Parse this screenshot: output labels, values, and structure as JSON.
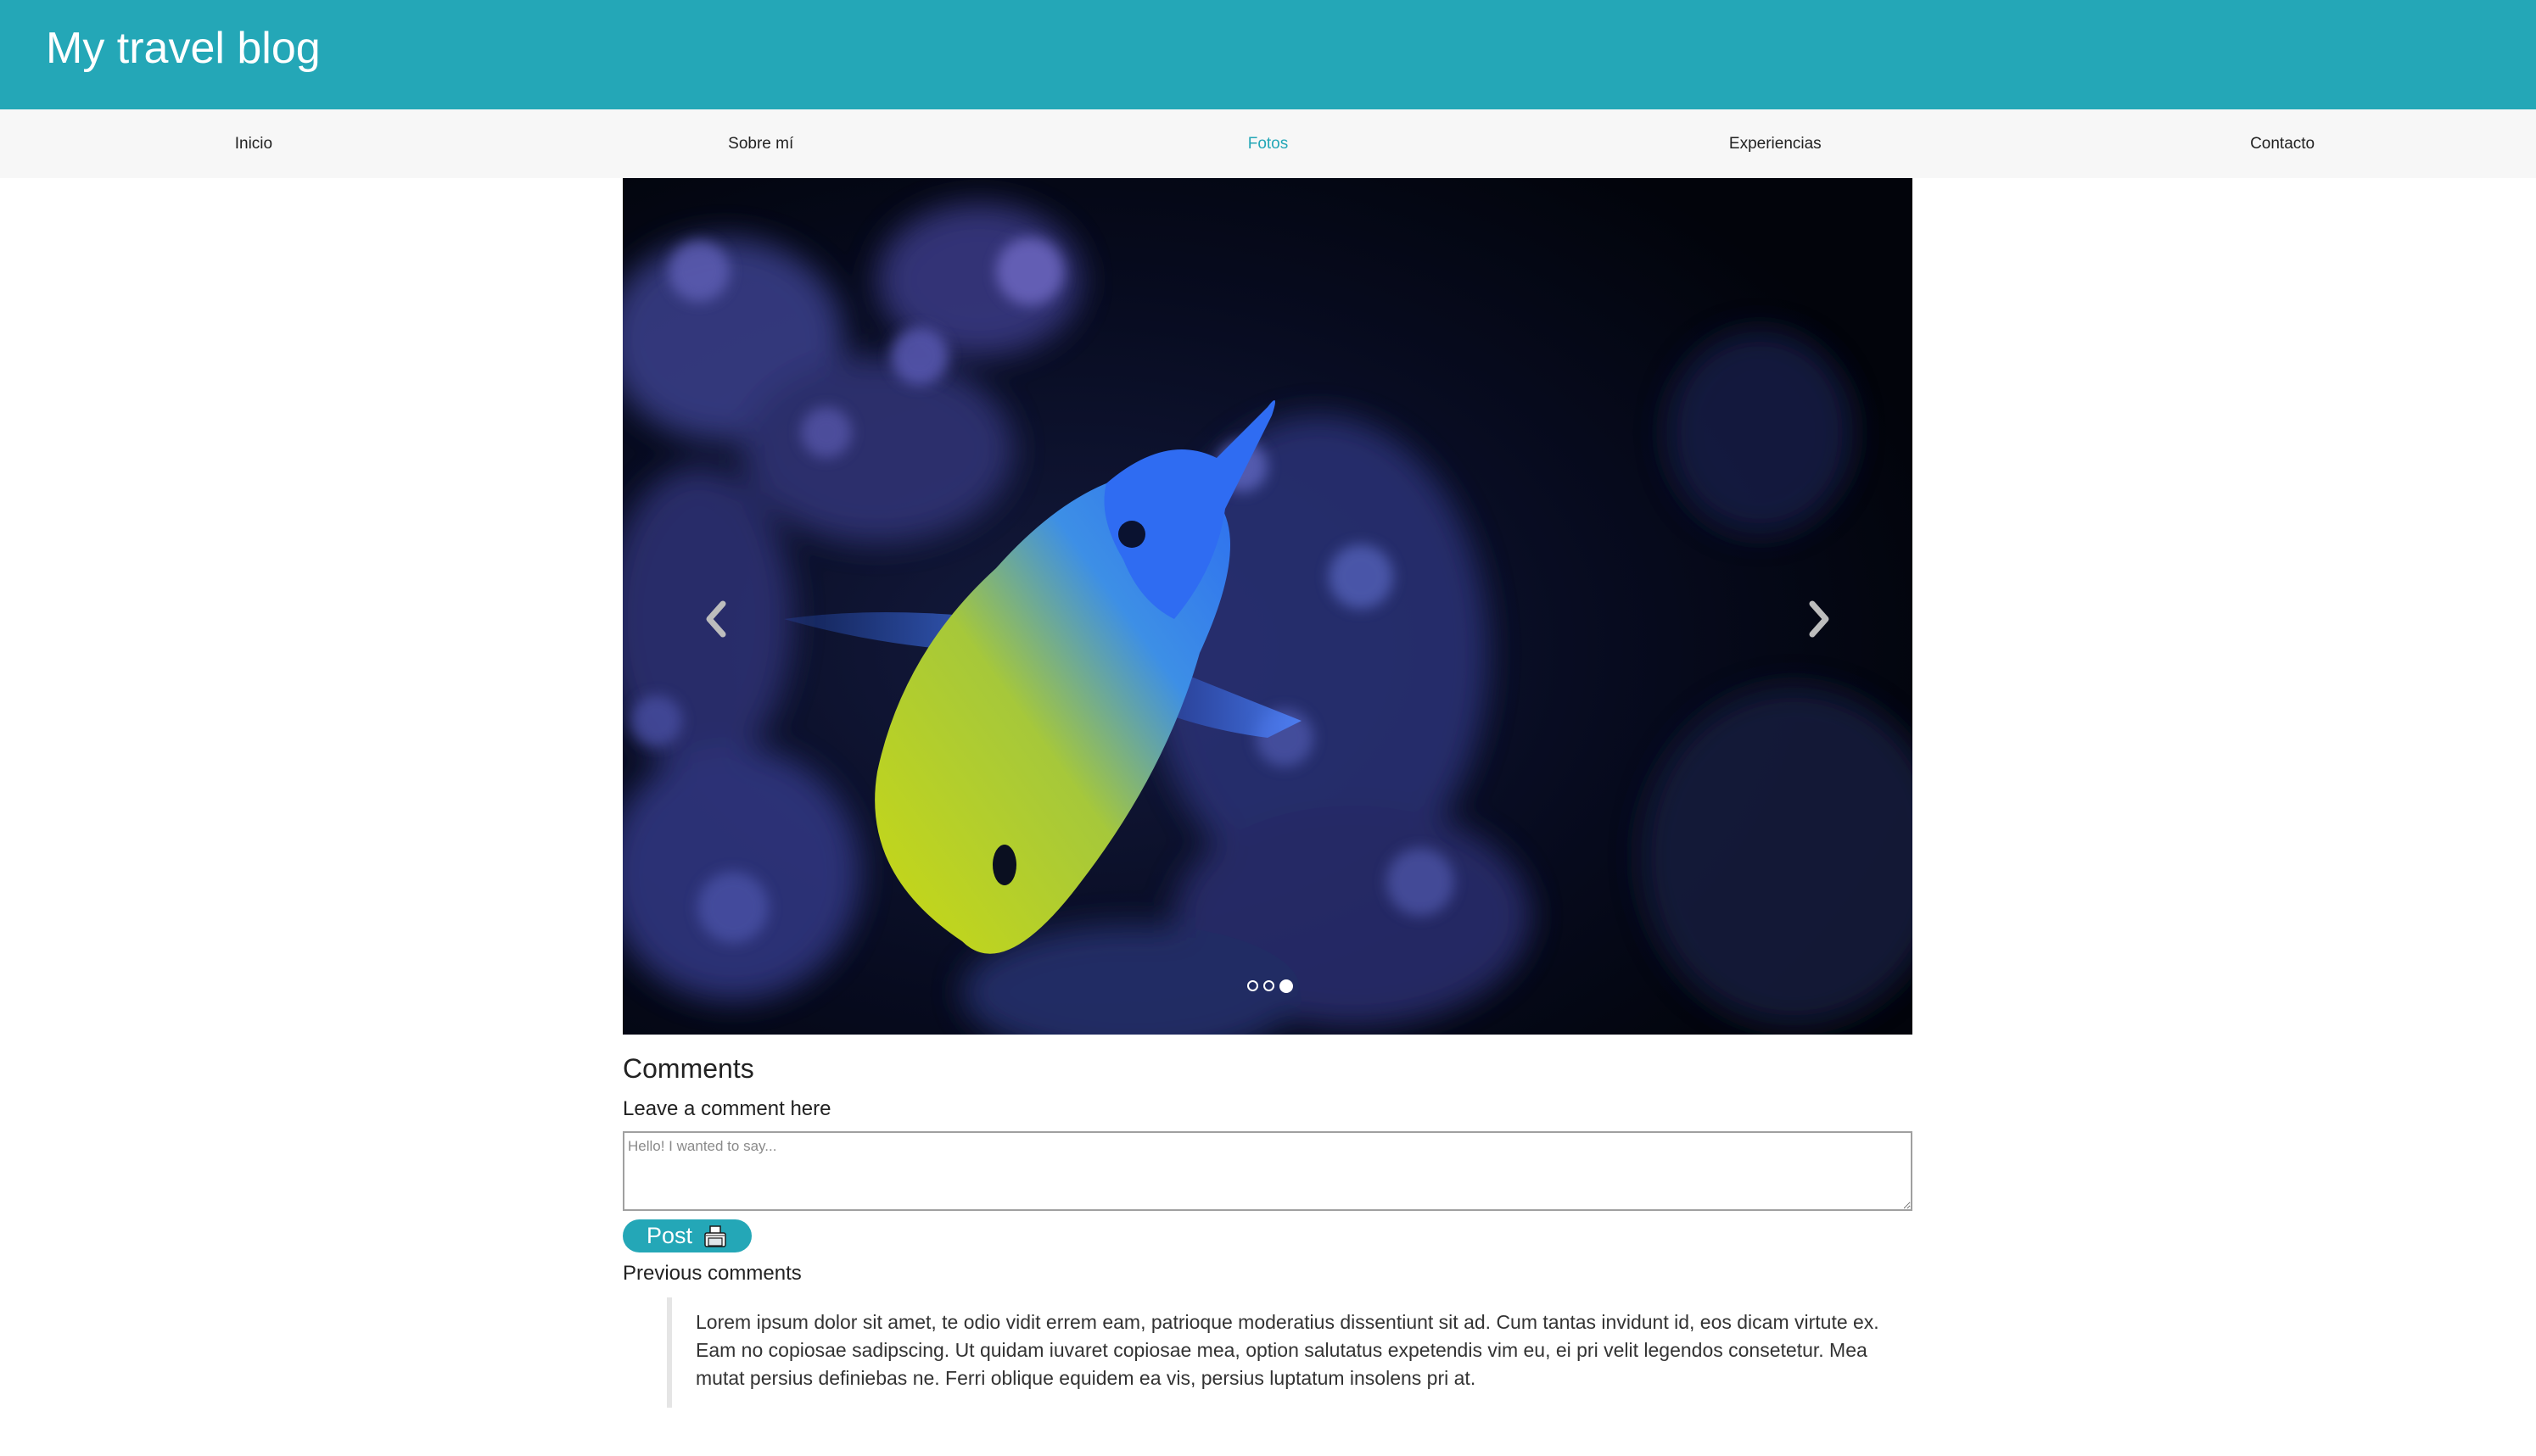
{
  "header": {
    "title": "My travel blog"
  },
  "nav": {
    "items": [
      {
        "label": "Inicio",
        "active": false
      },
      {
        "label": "Sobre mí",
        "active": false
      },
      {
        "label": "Fotos",
        "active": true
      },
      {
        "label": "Experiencias",
        "active": false
      },
      {
        "label": "Contacto",
        "active": false
      }
    ]
  },
  "carousel": {
    "image": "tropical-fish-aquarium-photo",
    "slide_count": 3,
    "active_index": 2,
    "prev_icon": "chevron-left-icon",
    "next_icon": "chevron-right-icon"
  },
  "comments": {
    "heading": "Comments",
    "leave_label": "Leave a comment here",
    "placeholder": "Hello! I wanted to say...",
    "value": "",
    "post_label": "Post",
    "post_icon": "printer-icon",
    "previous_label": "Previous comments",
    "previous": [
      {
        "text": "Lorem ipsum dolor sit amet, te odio vidit errem eam, patrioque moderatius dissentiunt sit ad. Cum tantas invidunt id, eos dicam virtute ex. Eam no copiosae sadipscing. Ut quidam iuvaret copiosae mea, option salutatus expetendis vim eu, ei pri velit legendos consetetur. Mea mutat persius definiebas ne. Ferri oblique equidem ea vis, persius luptatum insolens pri at."
      }
    ]
  },
  "colors": {
    "accent": "#24a7b7",
    "navbar_bg": "#f7f7f7"
  }
}
